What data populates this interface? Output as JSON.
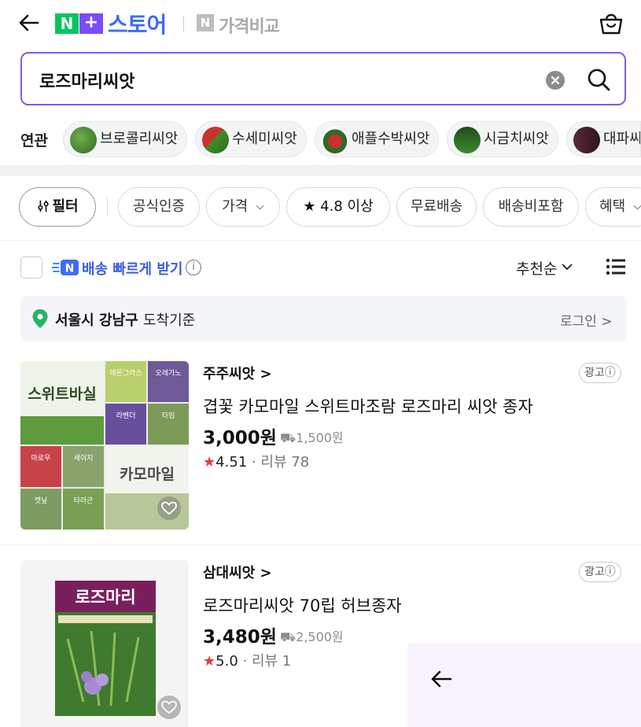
{
  "header": {
    "logo_n": "N",
    "logo_plus": "+",
    "logo_store": "스토어",
    "price_compare_n": "N",
    "price_compare": "가격비교"
  },
  "search": {
    "query": "로즈마리씨앗"
  },
  "related": {
    "label": "연관",
    "items": [
      {
        "label": "브로콜리씨앗"
      },
      {
        "label": "수세미씨앗"
      },
      {
        "label": "애플수박씨앗"
      },
      {
        "label": "시금치씨앗"
      },
      {
        "label": "대파씨"
      }
    ]
  },
  "filters": {
    "filter_label": "필터",
    "items": [
      {
        "label": "공식인증"
      },
      {
        "label": "가격"
      },
      {
        "label": "★ 4.8 이상"
      },
      {
        "label": "무료배송"
      },
      {
        "label": "배송비포함"
      },
      {
        "label": "혜택"
      }
    ]
  },
  "sort": {
    "fast_delivery": "배송 빠르게 받기",
    "info": "i",
    "sort_label": "추천순"
  },
  "location": {
    "place": "서울시 강남구",
    "suffix": "도착기준",
    "login": "로그인 >"
  },
  "products": [
    {
      "brand": "주주씨앗 >",
      "ad": "광고ⓘ",
      "name": "겹꽃 카모마일 스위트마조람 로즈마리 씨앗 종자",
      "price": "3,000원",
      "shipping": "⛟1,500원",
      "rating": "4.51",
      "reviews": "리뷰 78",
      "image_text": {
        "main1": "스위트바실",
        "small1": "레몬그라스",
        "small2": "오레가노",
        "small3": "라벤더",
        "small4": "타임",
        "small5": "마로우",
        "small6": "세이지",
        "main2": "카모마일",
        "small7": "캣닢",
        "small8": "타라곤"
      }
    },
    {
      "brand": "삼대씨앗 >",
      "ad": "광고ⓘ",
      "name": "로즈마리씨앗 70립 허브종자",
      "price": "3,480원",
      "shipping": "⛟2,500원",
      "rating": "5.0",
      "reviews": "리뷰 1",
      "image_text": {
        "title": "로즈마리"
      }
    }
  ],
  "colors": {
    "accent": "#7b5cf0",
    "naver_green": "#03c75a",
    "store_blue": "#3d6bff",
    "star_red": "#e23b3b"
  },
  "icons": {
    "back": "back-arrow-icon",
    "cart": "shopping-bag-icon",
    "search": "search-icon",
    "clear": "clear-icon",
    "location": "map-pin-icon",
    "list": "list-view-icon"
  }
}
